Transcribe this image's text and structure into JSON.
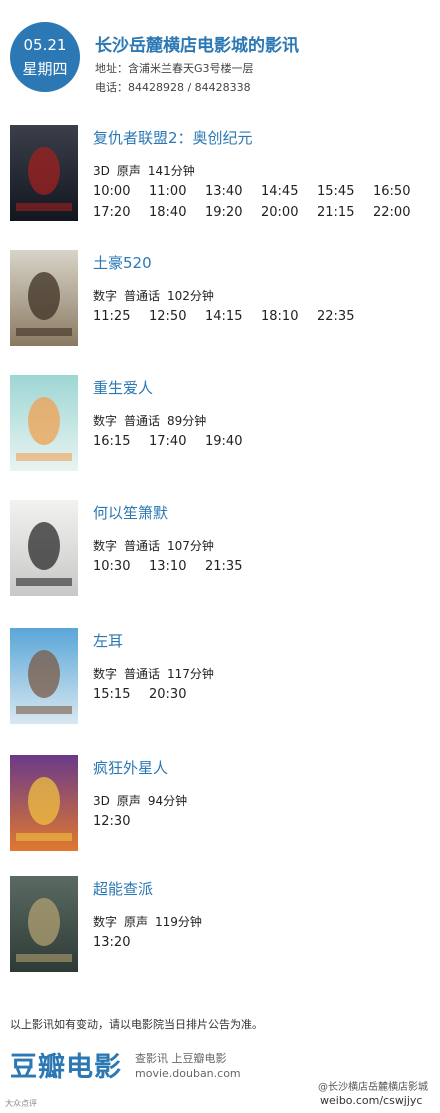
{
  "header": {
    "date": "05.21",
    "weekday": "星期四",
    "cinema_name": "长沙岳麓横店电影城的影讯",
    "address": "地址：含浦米兰春天G3号楼一层",
    "phone": "电话：84428928 / 84428338"
  },
  "movies": [
    {
      "title": "复仇者联盟2：奥创纪元",
      "format": "3D",
      "language": "原声",
      "duration": "141分钟",
      "times": [
        "10:00",
        "11:00",
        "13:40",
        "14:45",
        "15:45",
        "16:50",
        "17:20",
        "18:40",
        "19:20",
        "20:00",
        "21:15",
        "22:00"
      ],
      "poster_colors": [
        "#3a3f4a",
        "#12161f",
        "#a02020"
      ]
    },
    {
      "title": "土豪520",
      "format": "数字",
      "language": "普通话",
      "duration": "102分钟",
      "times": [
        "11:25",
        "12:50",
        "14:15",
        "18:10",
        "22:35"
      ],
      "poster_colors": [
        "#d8d4c8",
        "#8a7a62",
        "#3d3024"
      ]
    },
    {
      "title": "重生爱人",
      "format": "数字",
      "language": "普通话",
      "duration": "89分钟",
      "times": [
        "16:15",
        "17:40",
        "19:40"
      ],
      "poster_colors": [
        "#9ed6d4",
        "#e8f4f2",
        "#f0a050"
      ]
    },
    {
      "title": "何以笙箫默",
      "format": "数字",
      "language": "普通话",
      "duration": "107分钟",
      "times": [
        "10:30",
        "13:10",
        "21:35"
      ],
      "poster_colors": [
        "#f2f2f0",
        "#c8c8c8",
        "#2a2a2a"
      ]
    },
    {
      "title": "左耳",
      "format": "数字",
      "language": "普通话",
      "duration": "117分钟",
      "times": [
        "15:15",
        "20:30"
      ],
      "poster_colors": [
        "#5aa6d8",
        "#d8e8f0",
        "#7a5a44"
      ]
    },
    {
      "title": "疯狂外星人",
      "format": "3D",
      "language": "原声",
      "duration": "94分钟",
      "times": [
        "12:30"
      ],
      "poster_colors": [
        "#6a3a8a",
        "#e07830",
        "#f0c040"
      ]
    },
    {
      "title": "超能查派",
      "format": "数字",
      "language": "原声",
      "duration": "119分钟",
      "times": [
        "13:20"
      ],
      "poster_colors": [
        "#5a6a62",
        "#2e3a36",
        "#b0a070"
      ]
    }
  ],
  "footer": {
    "note": "以上影讯如有变动，请以电影院当日排片公告为准。",
    "logo": "豆瓣电影",
    "tagline": "查影讯  上豆瓣电影",
    "url": "movie.douban.com",
    "watermark": "@长沙横店岳麓横店影城",
    "weibo_url": "weibo.com/cswjjyc",
    "credit": "大众点评"
  }
}
